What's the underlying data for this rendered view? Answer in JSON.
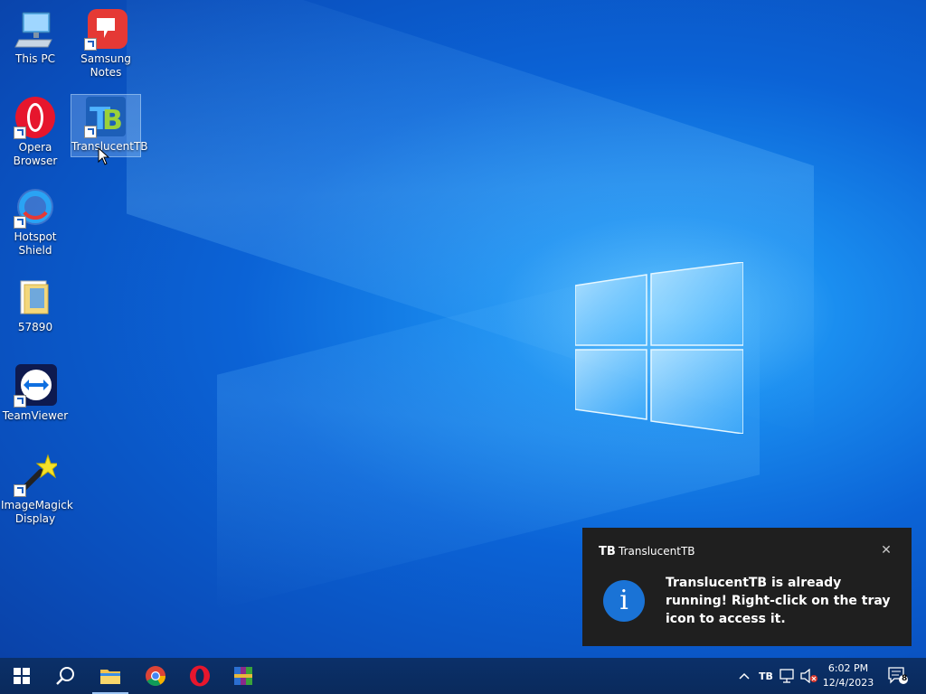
{
  "desktop": {
    "icons": [
      {
        "label": "This PC",
        "icon": "computer-icon"
      },
      {
        "label": "Samsung Notes",
        "icon": "samsung-notes-icon"
      },
      {
        "label": "Opera Browser",
        "icon": "opera-icon"
      },
      {
        "label": "TranslucentTB",
        "icon": "translucenttb-icon",
        "selected": true
      },
      {
        "label": "Hotspot Shield",
        "icon": "hotspot-shield-icon"
      },
      {
        "label": "57890",
        "icon": "folder-icon"
      },
      {
        "label": "TeamViewer",
        "icon": "teamviewer-icon"
      },
      {
        "label": "ImageMagick Display",
        "icon": "imagemagick-icon"
      }
    ]
  },
  "toast": {
    "app_name": "TranslucentTB",
    "app_icon_text": "TB",
    "message": "TranslucentTB is already running! Right-click on the tray icon to access it.",
    "info_glyph": "i",
    "close_glyph": "✕"
  },
  "taskbar": {
    "pinned": [
      "start-button",
      "search-button",
      "file-explorer",
      "chrome",
      "opera",
      "winrar"
    ],
    "tray": {
      "chevron": "^",
      "tb_glyph": "TB",
      "clock_time": "6:02 PM",
      "clock_date": "12/4/2023",
      "notification_count": "8"
    }
  },
  "colors": {
    "accent": "#1a73d6",
    "toast_bg": "#1f1f1f",
    "taskbar_bg": "#0a2a5c"
  }
}
